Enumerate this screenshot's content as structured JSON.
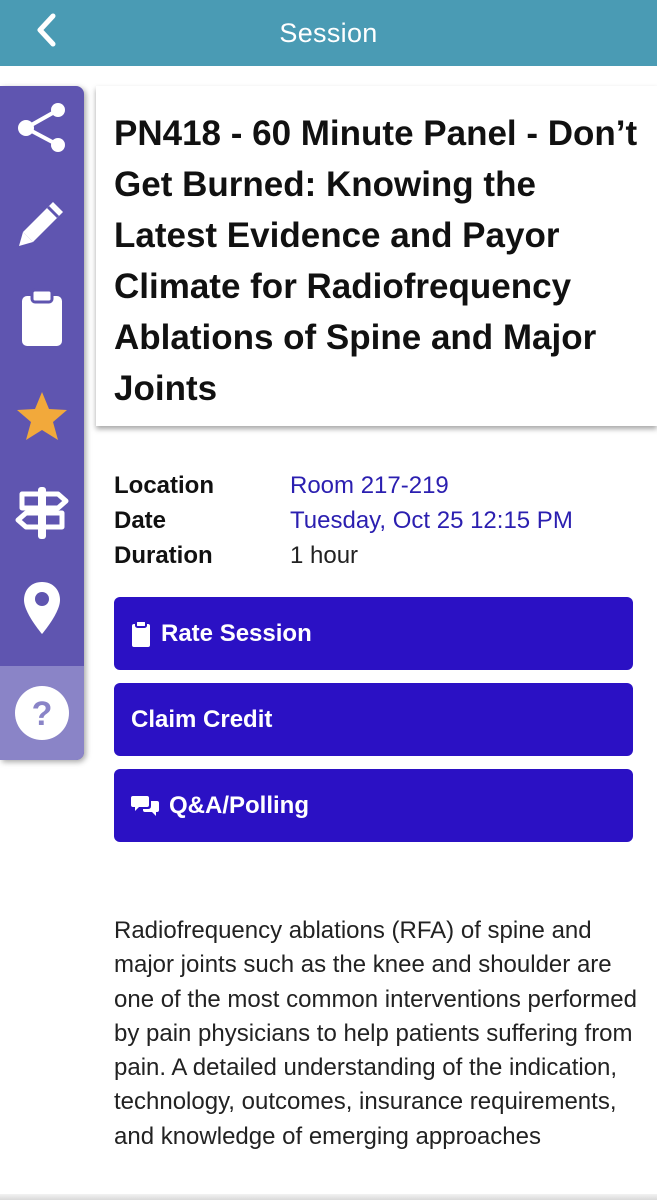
{
  "nav": {
    "title": "Session",
    "back_icon": "chevron-left-icon",
    "bar_color": "#4a9bb4"
  },
  "rail": {
    "color": "#5f55b0",
    "items": [
      {
        "icon": "share-icon"
      },
      {
        "icon": "pencil-icon"
      },
      {
        "icon": "clipboard-icon"
      },
      {
        "icon": "star-icon",
        "color": "#f2a93b"
      },
      {
        "icon": "signpost-icon"
      },
      {
        "icon": "map-pin-icon"
      },
      {
        "icon": "help-icon"
      }
    ]
  },
  "session": {
    "title": "PN418 - 60 Minute Panel - Don’t Get Burned: Knowing the Latest Evidence and Payor Climate for Radiofrequency Ablations of Spine and Major Joints",
    "location_label": "Location",
    "location": "Room 217-219",
    "date_label": "Date",
    "date": "Tuesday, Oct 25 12:15 PM",
    "duration_label": "Duration",
    "duration": "1 hour"
  },
  "actions": {
    "color": "#2b11c4",
    "rate_label": "Rate Session",
    "rate_icon": "clipboard-icon",
    "credit_label": "Claim Credit",
    "qa_label": "Q&A/Polling",
    "qa_icon": "chat-bubbles-icon"
  },
  "description": "Radiofrequency ablations (RFA) of spine and major joints such as the knee and shoulder are one of the most common interventions performed by pain physicians to help patients suffering from pain. A detailed understanding of the indication, technology, outcomes, insurance requirements, and knowledge of emerging approaches"
}
